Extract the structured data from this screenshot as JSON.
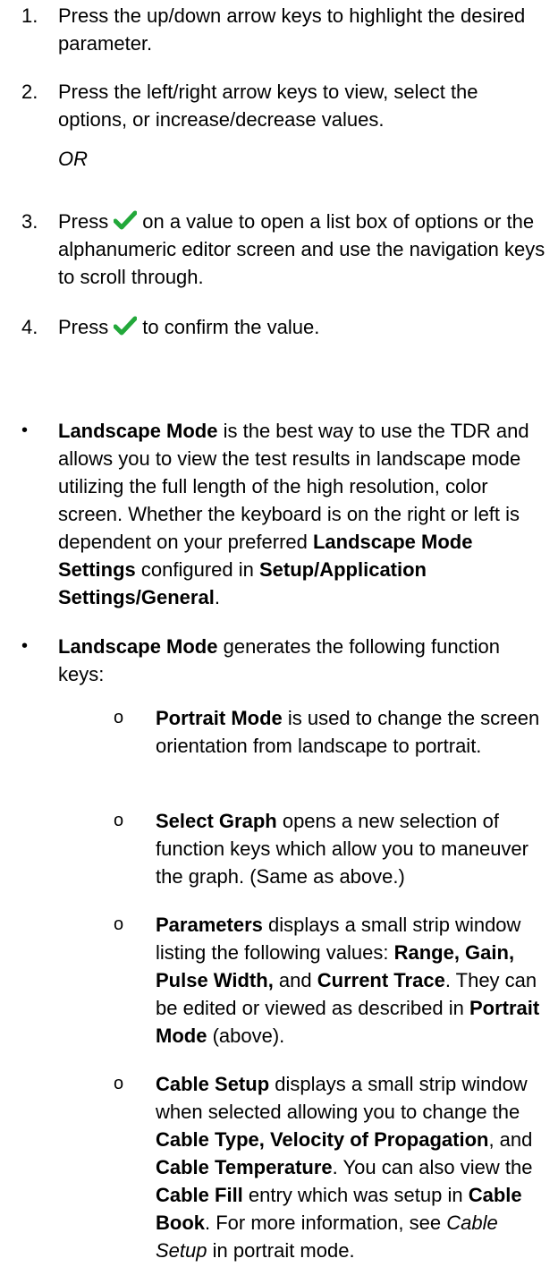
{
  "steps": [
    {
      "num": "1.",
      "text": "Press the up/down arrow keys to highlight the desired parameter."
    },
    {
      "num": "2.",
      "text": "Press the left/right arrow keys to view, select the options, or increase/decrease values."
    },
    {
      "num": "3.",
      "pre": "Press",
      "post": "on a value to open a list box of options or the alphanumeric editor screen and use the navigation keys to scroll through."
    },
    {
      "num": "4.",
      "pre": "Press",
      "post": "to confirm the value."
    }
  ],
  "or_text": "OR",
  "check_color": "#22a83a",
  "bullet_symbol": "•",
  "sub_symbol": "o",
  "bullets": [
    {
      "b1": "Landscape Mode",
      "t1": " is the best way to use the TDR and allows you to view the test results in landscape mode utilizing the full length of the high resolution, color screen. Whether the keyboard is on the right or left is dependent on your preferred ",
      "b2": "Landscape Mode Settings",
      "t2": " configured in ",
      "b3": "Setup/Application Settings/General",
      "t3": "."
    },
    {
      "b1": "Landscape Mode",
      "t1": " generates the following function keys:"
    }
  ],
  "subitems": [
    {
      "b1": "Portrait Mode",
      "t1": " is used to change the screen orientation from landscape to portrait."
    },
    {
      "b1": "Select Graph",
      "t1": " opens a new selection of function keys which allow you to maneuver the graph. (Same as above.)"
    },
    {
      "b1": "Parameters",
      "t1": " displays a small strip window listing the following values: ",
      "b2": "Range, Gain, Pulse Width,",
      "t2": " and ",
      "b3": "Current Trace",
      "t3": ". They can be edited or viewed as described in ",
      "b4": "Portrait Mode",
      "t4": " (above)."
    },
    {
      "b1": "Cable Setup",
      "t1": " displays a small strip window when selected allowing you to change the ",
      "b2": "Cable Type, Velocity of Propagation",
      "t2": ", and ",
      "b3": "Cable Temperature",
      "t3": ". You can also view the ",
      "b4": "Cable Fill",
      "t4": " entry which was setup in ",
      "b5": "Cable Book",
      "t5": ". For more information, see ",
      "i1": "Cable Setup",
      "t6": " in portrait mode."
    }
  ]
}
